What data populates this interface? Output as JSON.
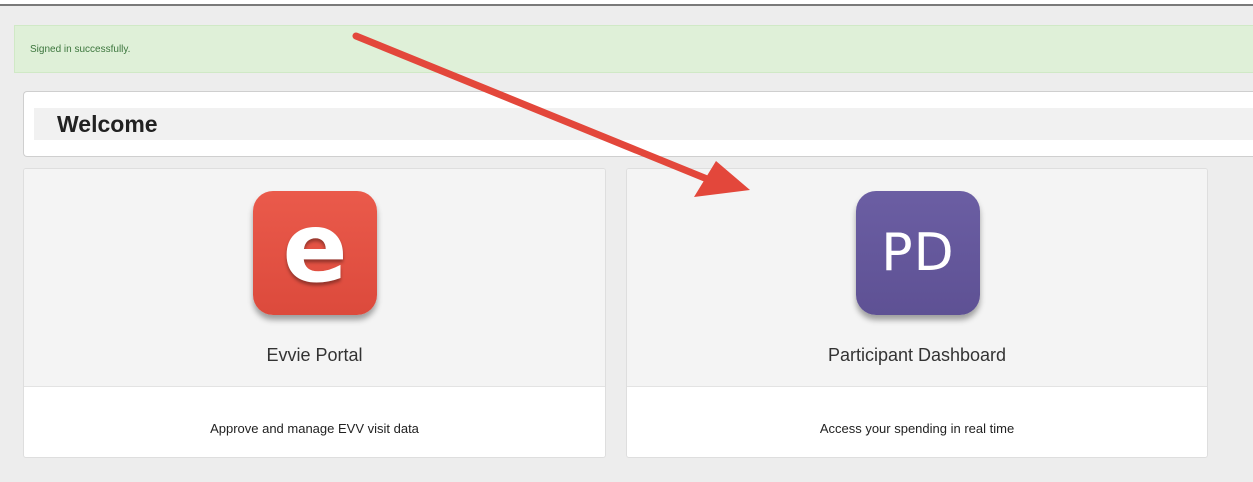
{
  "alert": {
    "message": "Signed in successfully."
  },
  "welcome": {
    "title": "Welcome"
  },
  "cards": [
    {
      "icon_name": "evvie-app-icon",
      "icon_text": "e",
      "icon_color": "#e4503f",
      "title": "Evvie Portal",
      "description": "Approve and manage EVV visit data"
    },
    {
      "icon_name": "participant-dashboard-app-icon",
      "icon_text": "PD",
      "icon_color": "#65589c",
      "title": "Participant Dashboard",
      "description": "Access your spending in real time"
    }
  ],
  "annotation": {
    "arrow_color": "#e3473b"
  }
}
